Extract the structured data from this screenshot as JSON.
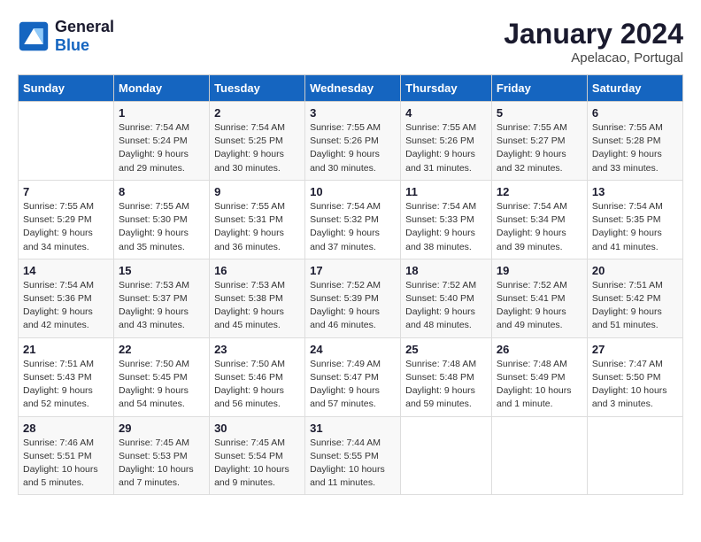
{
  "header": {
    "logo_text_general": "General",
    "logo_text_blue": "Blue",
    "month": "January 2024",
    "location": "Apelacao, Portugal"
  },
  "days_of_week": [
    "Sunday",
    "Monday",
    "Tuesday",
    "Wednesday",
    "Thursday",
    "Friday",
    "Saturday"
  ],
  "weeks": [
    [
      {
        "day": "",
        "info": ""
      },
      {
        "day": "1",
        "info": "Sunrise: 7:54 AM\nSunset: 5:24 PM\nDaylight: 9 hours\nand 29 minutes."
      },
      {
        "day": "2",
        "info": "Sunrise: 7:54 AM\nSunset: 5:25 PM\nDaylight: 9 hours\nand 30 minutes."
      },
      {
        "day": "3",
        "info": "Sunrise: 7:55 AM\nSunset: 5:26 PM\nDaylight: 9 hours\nand 30 minutes."
      },
      {
        "day": "4",
        "info": "Sunrise: 7:55 AM\nSunset: 5:26 PM\nDaylight: 9 hours\nand 31 minutes."
      },
      {
        "day": "5",
        "info": "Sunrise: 7:55 AM\nSunset: 5:27 PM\nDaylight: 9 hours\nand 32 minutes."
      },
      {
        "day": "6",
        "info": "Sunrise: 7:55 AM\nSunset: 5:28 PM\nDaylight: 9 hours\nand 33 minutes."
      }
    ],
    [
      {
        "day": "7",
        "info": "Sunrise: 7:55 AM\nSunset: 5:29 PM\nDaylight: 9 hours\nand 34 minutes."
      },
      {
        "day": "8",
        "info": "Sunrise: 7:55 AM\nSunset: 5:30 PM\nDaylight: 9 hours\nand 35 minutes."
      },
      {
        "day": "9",
        "info": "Sunrise: 7:55 AM\nSunset: 5:31 PM\nDaylight: 9 hours\nand 36 minutes."
      },
      {
        "day": "10",
        "info": "Sunrise: 7:54 AM\nSunset: 5:32 PM\nDaylight: 9 hours\nand 37 minutes."
      },
      {
        "day": "11",
        "info": "Sunrise: 7:54 AM\nSunset: 5:33 PM\nDaylight: 9 hours\nand 38 minutes."
      },
      {
        "day": "12",
        "info": "Sunrise: 7:54 AM\nSunset: 5:34 PM\nDaylight: 9 hours\nand 39 minutes."
      },
      {
        "day": "13",
        "info": "Sunrise: 7:54 AM\nSunset: 5:35 PM\nDaylight: 9 hours\nand 41 minutes."
      }
    ],
    [
      {
        "day": "14",
        "info": "Sunrise: 7:54 AM\nSunset: 5:36 PM\nDaylight: 9 hours\nand 42 minutes."
      },
      {
        "day": "15",
        "info": "Sunrise: 7:53 AM\nSunset: 5:37 PM\nDaylight: 9 hours\nand 43 minutes."
      },
      {
        "day": "16",
        "info": "Sunrise: 7:53 AM\nSunset: 5:38 PM\nDaylight: 9 hours\nand 45 minutes."
      },
      {
        "day": "17",
        "info": "Sunrise: 7:52 AM\nSunset: 5:39 PM\nDaylight: 9 hours\nand 46 minutes."
      },
      {
        "day": "18",
        "info": "Sunrise: 7:52 AM\nSunset: 5:40 PM\nDaylight: 9 hours\nand 48 minutes."
      },
      {
        "day": "19",
        "info": "Sunrise: 7:52 AM\nSunset: 5:41 PM\nDaylight: 9 hours\nand 49 minutes."
      },
      {
        "day": "20",
        "info": "Sunrise: 7:51 AM\nSunset: 5:42 PM\nDaylight: 9 hours\nand 51 minutes."
      }
    ],
    [
      {
        "day": "21",
        "info": "Sunrise: 7:51 AM\nSunset: 5:43 PM\nDaylight: 9 hours\nand 52 minutes."
      },
      {
        "day": "22",
        "info": "Sunrise: 7:50 AM\nSunset: 5:45 PM\nDaylight: 9 hours\nand 54 minutes."
      },
      {
        "day": "23",
        "info": "Sunrise: 7:50 AM\nSunset: 5:46 PM\nDaylight: 9 hours\nand 56 minutes."
      },
      {
        "day": "24",
        "info": "Sunrise: 7:49 AM\nSunset: 5:47 PM\nDaylight: 9 hours\nand 57 minutes."
      },
      {
        "day": "25",
        "info": "Sunrise: 7:48 AM\nSunset: 5:48 PM\nDaylight: 9 hours\nand 59 minutes."
      },
      {
        "day": "26",
        "info": "Sunrise: 7:48 AM\nSunset: 5:49 PM\nDaylight: 10 hours\nand 1 minute."
      },
      {
        "day": "27",
        "info": "Sunrise: 7:47 AM\nSunset: 5:50 PM\nDaylight: 10 hours\nand 3 minutes."
      }
    ],
    [
      {
        "day": "28",
        "info": "Sunrise: 7:46 AM\nSunset: 5:51 PM\nDaylight: 10 hours\nand 5 minutes."
      },
      {
        "day": "29",
        "info": "Sunrise: 7:45 AM\nSunset: 5:53 PM\nDaylight: 10 hours\nand 7 minutes."
      },
      {
        "day": "30",
        "info": "Sunrise: 7:45 AM\nSunset: 5:54 PM\nDaylight: 10 hours\nand 9 minutes."
      },
      {
        "day": "31",
        "info": "Sunrise: 7:44 AM\nSunset: 5:55 PM\nDaylight: 10 hours\nand 11 minutes."
      },
      {
        "day": "",
        "info": ""
      },
      {
        "day": "",
        "info": ""
      },
      {
        "day": "",
        "info": ""
      }
    ]
  ]
}
